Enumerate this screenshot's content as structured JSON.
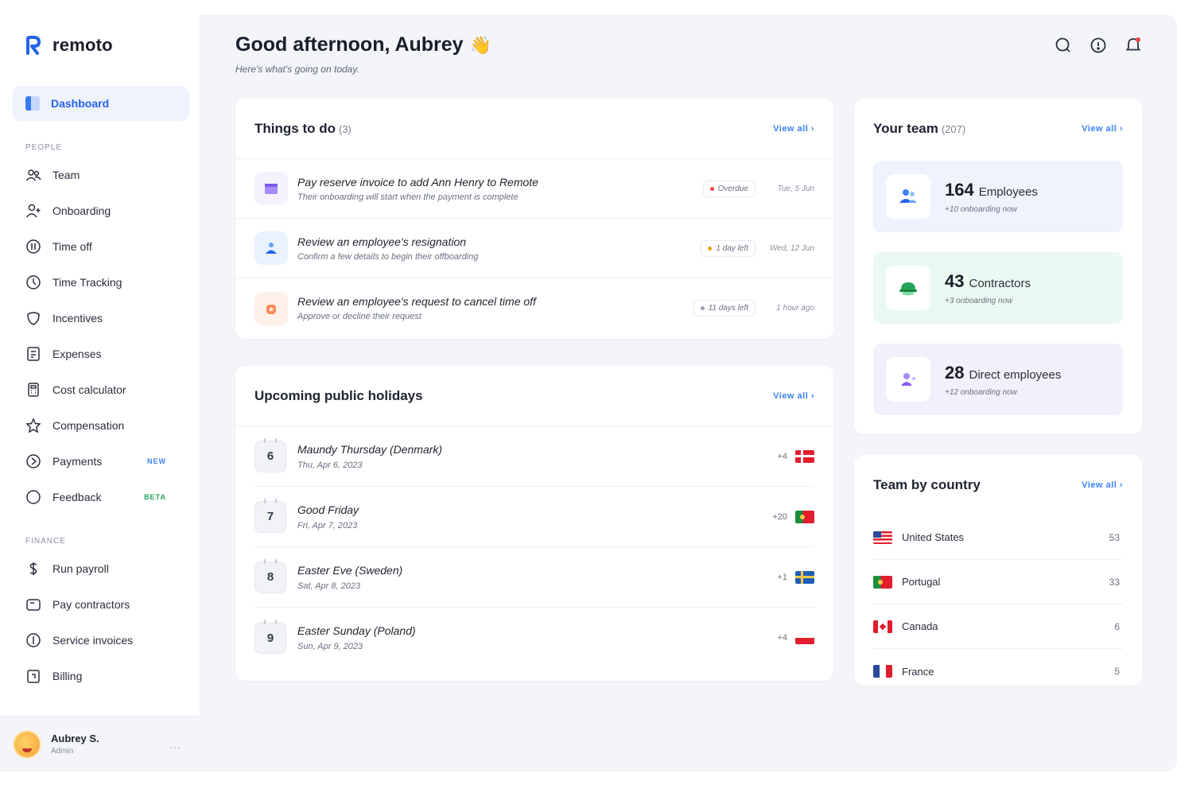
{
  "brand": {
    "name": "remoto"
  },
  "sidebar": {
    "active": "Dashboard",
    "section_people": "People",
    "people_items": [
      {
        "label": "Team"
      },
      {
        "label": "Onboarding"
      },
      {
        "label": "Time off"
      },
      {
        "label": "Time Tracking"
      },
      {
        "label": "Incentives"
      },
      {
        "label": "Expenses"
      },
      {
        "label": "Cost calculator"
      },
      {
        "label": "Compensation"
      },
      {
        "label": "Payments",
        "badge": "NEW"
      },
      {
        "label": "Feedback",
        "badge": "BETA"
      }
    ],
    "section_finance": "Finance",
    "finance_items": [
      {
        "label": "Run payroll"
      },
      {
        "label": "Pay contractors"
      },
      {
        "label": "Service invoices"
      },
      {
        "label": "Billing"
      }
    ]
  },
  "user": {
    "name": "Aubrey S.",
    "role": "Admin",
    "more": "..."
  },
  "header": {
    "greeting": "Good afternoon, Aubrey",
    "wave": "👋",
    "subtitle": "Here's what's going on today."
  },
  "todo": {
    "title": "Things to do",
    "count": "(3)",
    "view_all": "View all ›",
    "items": [
      {
        "title": "Pay reserve invoice to add Ann Henry to Remote",
        "sub": "Their onboarding will start when the payment is complete",
        "pill": "Overdue",
        "pill_color": "#ef4444",
        "date": "Tue, 5 Jun"
      },
      {
        "title": "Review an employee's resignation",
        "sub": "Confirm a few details to begin their offboarding",
        "pill": "1 day left",
        "pill_color": "#f59e0b",
        "date": "Wed, 12 Jun"
      },
      {
        "title": "Review an employee's request to cancel time off",
        "sub": "Approve or decline their request",
        "pill": "11 days left",
        "pill_color": "#9aa0ad",
        "date": "1 hour ago"
      }
    ]
  },
  "holidays": {
    "title": "Upcoming public holidays",
    "view_all": "View all ›",
    "items": [
      {
        "day": "6",
        "name": "Maundy Thursday (Denmark)",
        "date": "Thu, Apr 6, 2023",
        "count": "+4",
        "flag": "dk"
      },
      {
        "day": "7",
        "name": "Good Friday",
        "date": "Fri, Apr 7, 2023",
        "count": "+20",
        "flag": "pt"
      },
      {
        "day": "8",
        "name": "Easter Eve (Sweden)",
        "date": "Sat, Apr 8, 2023",
        "count": "+1",
        "flag": "se"
      },
      {
        "day": "9",
        "name": "Easter Sunday (Poland)",
        "date": "Sun, Apr 9, 2023",
        "count": "+4",
        "flag": "pl"
      }
    ]
  },
  "team": {
    "title": "Your team",
    "count": "(207)",
    "view_all": "View all ›",
    "tiles": [
      {
        "num": "164",
        "label": "Employees",
        "sub": "+10 onboarding now",
        "bg": "#eef3fd"
      },
      {
        "num": "43",
        "label": "Contractors",
        "sub": "+3 onboarding now",
        "bg": "#eafaf2"
      },
      {
        "num": "28",
        "label": "Direct employees",
        "sub": "+12 onboarding now",
        "bg": "#f1f0fb"
      }
    ]
  },
  "country": {
    "title": "Team by country",
    "view_all": "View all ›",
    "items": [
      {
        "name": "United States",
        "count": "53",
        "flag": "us"
      },
      {
        "name": "Portugal",
        "count": "33",
        "flag": "pt"
      },
      {
        "name": "Canada",
        "count": "6",
        "flag": "ca"
      },
      {
        "name": "France",
        "count": "5",
        "flag": "fr"
      }
    ]
  }
}
